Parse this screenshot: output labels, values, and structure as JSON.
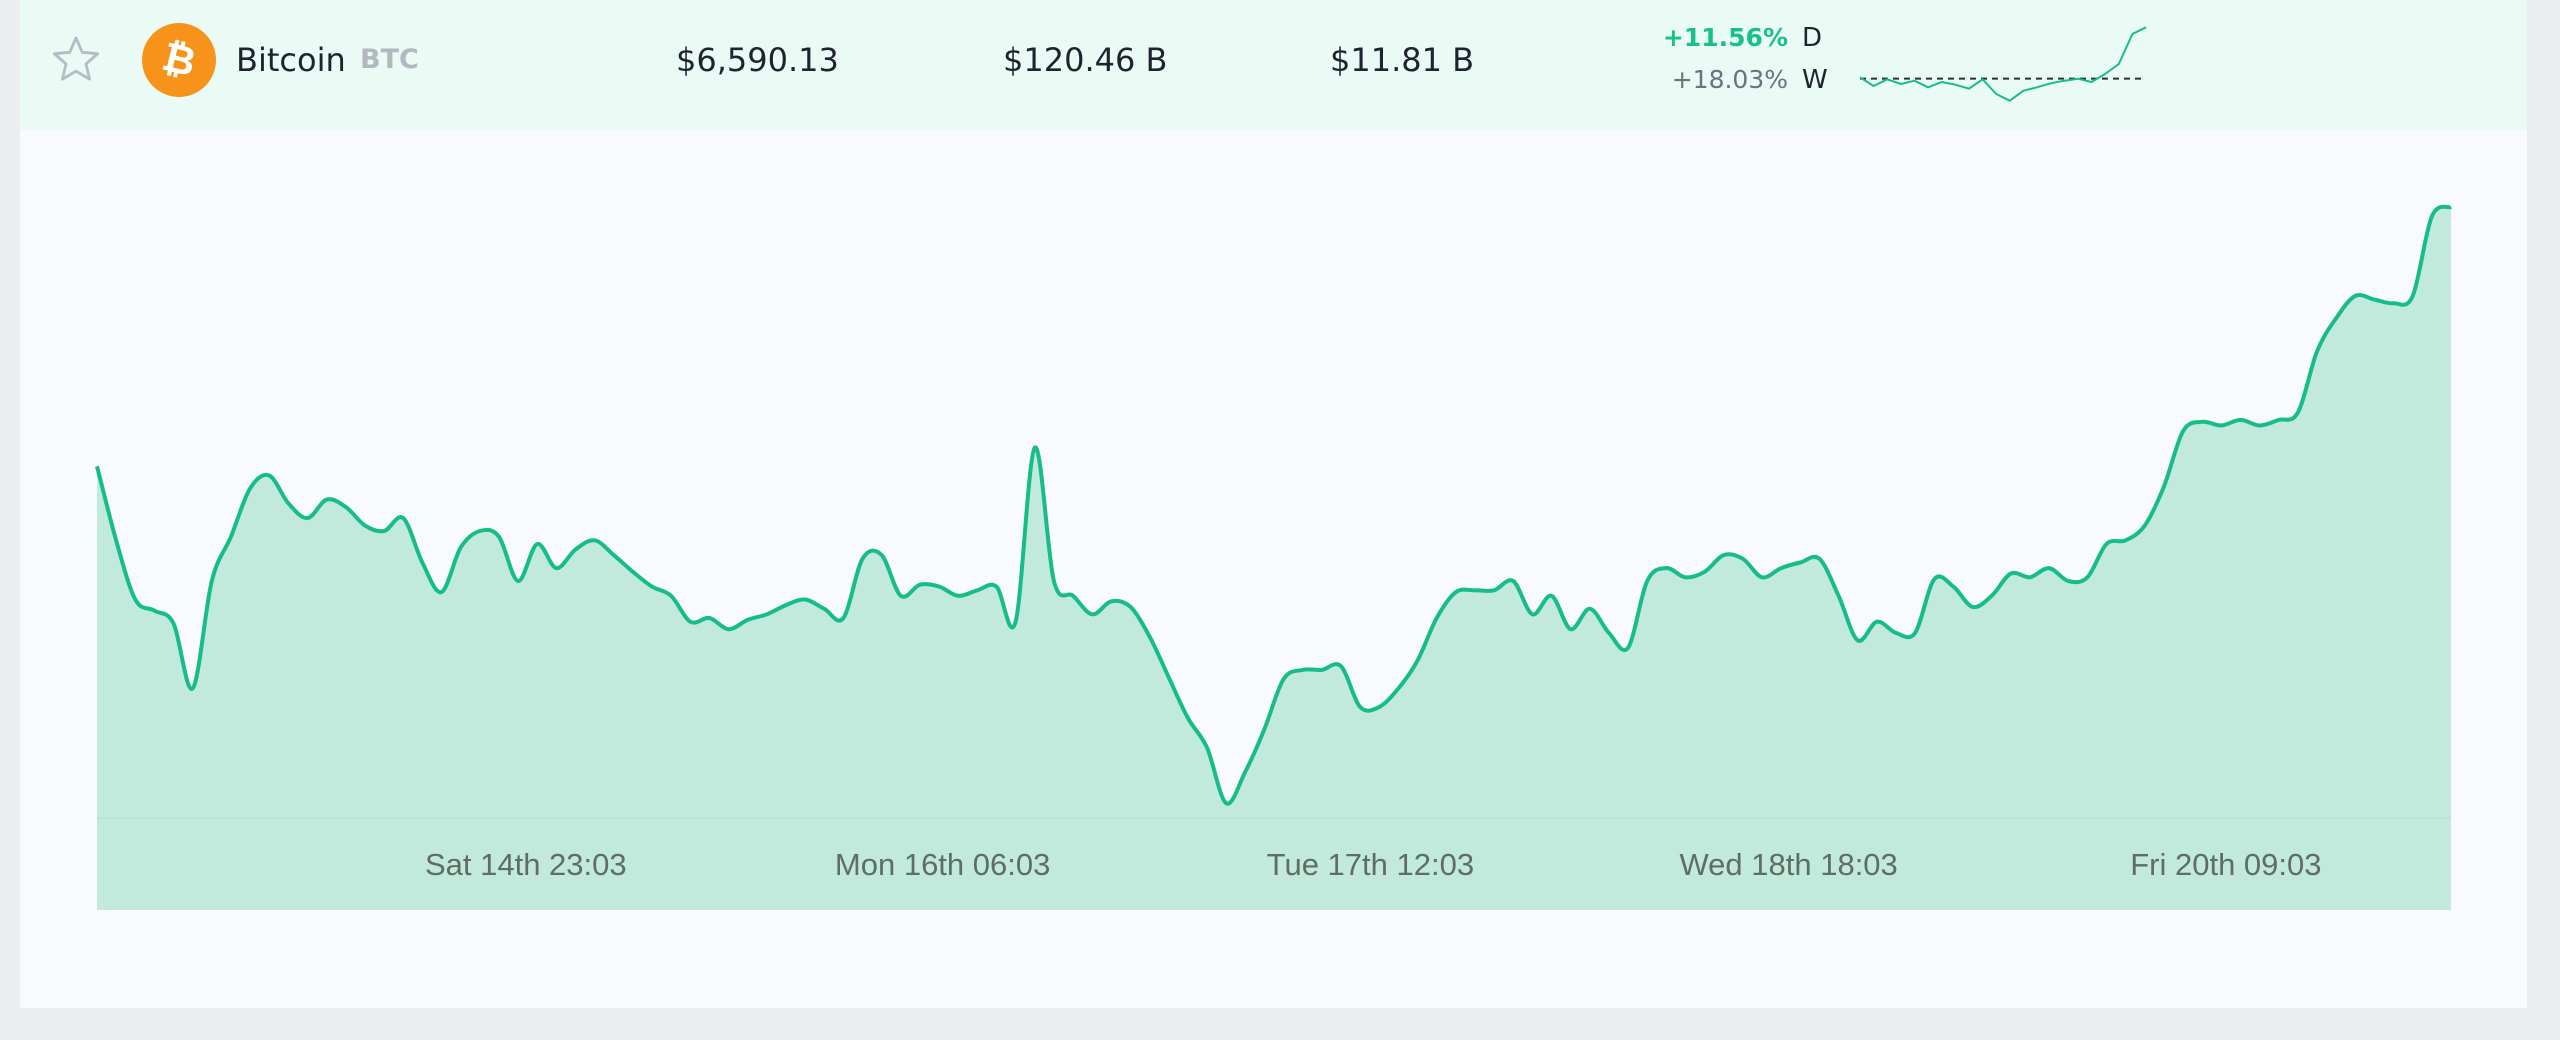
{
  "coin": {
    "name": "Bitcoin",
    "symbol": "BTC",
    "price": "$6,590.13",
    "market_cap": "$120.46 B",
    "volume": "$11.81 B",
    "change_day": "+11.56%",
    "change_day_label": "D",
    "change_week": "+18.03%",
    "change_week_label": "W",
    "icon": "bitcoin-icon",
    "favorite_icon": "star-outline-icon"
  },
  "colors": {
    "line": "#17bd86",
    "area": "#c1eadc",
    "row_bg": "#e9fbf4",
    "coin_orange": "#f7931a",
    "positive": "#19c08a"
  },
  "chart_data": {
    "type": "area",
    "x_ticks": [
      "Sat 14th 23:03",
      "Mon 16th 06:03",
      "Tue 17th 12:03",
      "Wed 18th 18:03",
      "Fri 20th 09:03"
    ],
    "x_tick_positions": [
      0.225,
      0.405,
      0.585,
      0.765,
      0.945
    ],
    "values": [
      5950,
      5910,
      5878,
      5872,
      5865,
      5830,
      5888,
      5912,
      5938,
      5945,
      5930,
      5922,
      5932,
      5928,
      5918,
      5915,
      5922,
      5898,
      5882,
      5906,
      5915,
      5912,
      5888,
      5908,
      5895,
      5905,
      5910,
      5902,
      5893,
      5885,
      5880,
      5866,
      5868,
      5862,
      5867,
      5870,
      5875,
      5878,
      5873,
      5868,
      5900,
      5902,
      5880,
      5886,
      5885,
      5880,
      5883,
      5885,
      5866,
      5960,
      5888,
      5880,
      5870,
      5877,
      5874,
      5858,
      5836,
      5814,
      5798,
      5768,
      5785,
      5808,
      5835,
      5840,
      5840,
      5842,
      5820,
      5820,
      5830,
      5845,
      5868,
      5882,
      5883,
      5883,
      5888,
      5870,
      5880,
      5862,
      5873,
      5860,
      5852,
      5888,
      5895,
      5890,
      5893,
      5902,
      5900,
      5890,
      5895,
      5898,
      5900,
      5880,
      5856,
      5866,
      5860,
      5860,
      5889,
      5885,
      5874,
      5880,
      5892,
      5890,
      5895,
      5888,
      5890,
      5908,
      5910,
      5918,
      5939,
      5969,
      5974,
      5972,
      5975,
      5972,
      5975,
      5979,
      6012,
      6030,
      6042,
      6040,
      6038,
      6042,
      6085,
      6090
    ],
    "ylim": [
      5760,
      6110
    ],
    "grid": false,
    "legend": "none"
  },
  "sparkline": {
    "type": "line",
    "values": [
      5895,
      5882,
      5892,
      5885,
      5890,
      5880,
      5888,
      5884,
      5878,
      5892,
      5870,
      5860,
      5875,
      5880,
      5886,
      5890,
      5893,
      5888,
      5900,
      5915,
      5960,
      5970
    ],
    "baseline": 5893
  }
}
